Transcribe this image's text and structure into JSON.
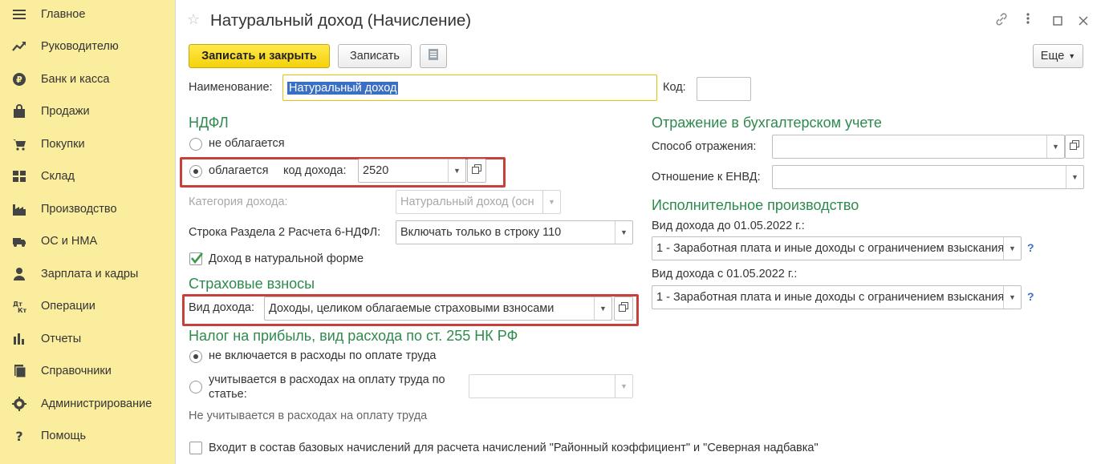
{
  "sidebar": {
    "items": [
      {
        "label": "Главное",
        "icon": "menu-icon"
      },
      {
        "label": "Руководителю",
        "icon": "trend-icon"
      },
      {
        "label": "Банк и касса",
        "icon": "ruble-icon"
      },
      {
        "label": "Продажи",
        "icon": "bag-icon"
      },
      {
        "label": "Покупки",
        "icon": "cart-icon"
      },
      {
        "label": "Склад",
        "icon": "warehouse-icon"
      },
      {
        "label": "Производство",
        "icon": "factory-icon"
      },
      {
        "label": "ОС и НМА",
        "icon": "truck-icon"
      },
      {
        "label": "Зарплата и кадры",
        "icon": "person-icon"
      },
      {
        "label": "Операции",
        "icon": "operations-icon"
      },
      {
        "label": "Отчеты",
        "icon": "bar-chart-icon"
      },
      {
        "label": "Справочники",
        "icon": "books-icon"
      },
      {
        "label": "Администрирование",
        "icon": "gear-icon"
      },
      {
        "label": "Помощь",
        "icon": "question-icon"
      }
    ]
  },
  "window": {
    "title": "Натуральный доход (Начисление)"
  },
  "toolbar": {
    "save_close": "Записать и закрыть",
    "save": "Записать",
    "more": "Еще"
  },
  "form": {
    "name_label": "Наименование:",
    "name_value": "Натуральный доход",
    "code_label": "Код:",
    "code_value": "",
    "ndfl": {
      "title": "НДФЛ",
      "not_taxed": "не облагается",
      "taxed": "облагается",
      "income_code_label": "код дохода:",
      "income_code_value": "2520",
      "category_label": "Категория дохода:",
      "category_value": "Натуральный доход (осн",
      "row_label": "Строка Раздела 2 Расчета 6-НДФЛ:",
      "row_value": "Включать только в строку 110",
      "in_kind_label": "Доход в натуральной форме",
      "in_kind_checked": true
    },
    "insurance": {
      "title": "Страховые взносы",
      "income_type_label": "Вид дохода:",
      "income_type_value": "Доходы, целиком облагаемые страховыми взносами"
    },
    "profit_tax": {
      "title": "Налог на прибыль, вид расхода по ст. 255 НК РФ",
      "option1": "не включается в расходы по оплате труда",
      "option2_line1": "учитывается в расходах на оплату труда по",
      "option2_line2": "статье:",
      "option2_value": "",
      "note": "Не учитывается в расходах на оплату труда"
    },
    "accounting": {
      "title": "Отражение в бухгалтерском учете",
      "method_label": "Способ отражения:",
      "method_value": "",
      "envd_label": "Отношение к ЕНВД:",
      "envd_value": ""
    },
    "enforcement": {
      "title": "Исполнительное производство",
      "before_label": "Вид дохода до 01.05.2022 г.:",
      "before_value": "1 - Заработная плата и иные доходы с ограничением взыскания",
      "after_label": "Вид дохода с 01.05.2022 г.:",
      "after_value": "1 - Заработная плата и иные доходы с ограничением взыскания",
      "help": "?"
    },
    "regional_label": "Входит в состав базовых начислений для расчета начислений \"Районный коэффициент\" и \"Северная надбавка\""
  }
}
